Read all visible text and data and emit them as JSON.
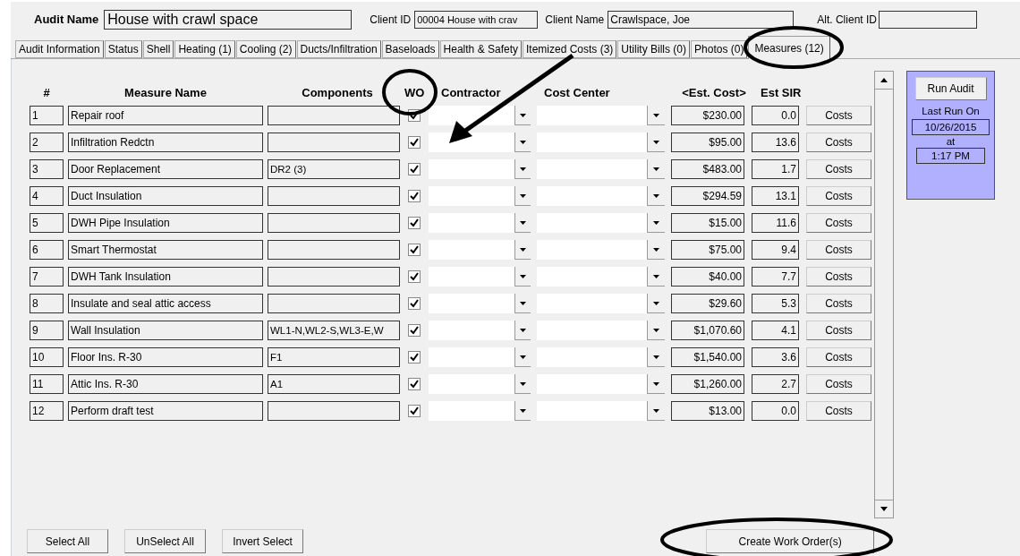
{
  "header": {
    "audit_name_label": "Audit Name",
    "audit_name": "House with crawl space",
    "client_id_label": "Client ID",
    "client_id": "00004 House with crav",
    "client_name_label": "Client Name",
    "client_name": "Crawlspace, Joe",
    "alt_client_id_label": "Alt. Client ID"
  },
  "tabs": [
    {
      "label": "Audit Information",
      "selected": false
    },
    {
      "label": "Status",
      "selected": false
    },
    {
      "label": "Shell",
      "selected": false
    },
    {
      "label": "Heating (1)",
      "selected": false
    },
    {
      "label": "Cooling (2)",
      "selected": false
    },
    {
      "label": "Ducts/Infiltration",
      "selected": false
    },
    {
      "label": "Baseloads",
      "selected": false
    },
    {
      "label": "Health & Safety",
      "selected": false
    },
    {
      "label": "Itemized Costs (3)",
      "selected": false
    },
    {
      "label": "Utility Bills (0)",
      "selected": false
    },
    {
      "label": "Photos (0)",
      "selected": false
    },
    {
      "label": "Measures (12)",
      "selected": true
    }
  ],
  "columns": [
    "#",
    "Measure Name",
    "Components",
    "WO",
    "Contractor",
    "Cost Center",
    "<Est. Cost>",
    "Est SIR"
  ],
  "rows": [
    {
      "number": "1",
      "name": "Repair roof",
      "components": "",
      "wo": true,
      "est_cost": "$230.00",
      "est_sir": "0.0",
      "button": "Costs"
    },
    {
      "number": "2",
      "name": "Infiltration Redctn",
      "components": "",
      "wo": true,
      "est_cost": "$95.00",
      "est_sir": "13.6",
      "button": "Costs"
    },
    {
      "number": "3",
      "name": "Door Replacement",
      "components": "DR2 (3)",
      "wo": true,
      "est_cost": "$483.00",
      "est_sir": "1.7",
      "button": "Costs"
    },
    {
      "number": "4",
      "name": "Duct Insulation",
      "components": "",
      "wo": true,
      "est_cost": "$294.59",
      "est_sir": "13.1",
      "button": "Costs"
    },
    {
      "number": "5",
      "name": "DWH Pipe Insulation",
      "components": "",
      "wo": true,
      "est_cost": "$15.00",
      "est_sir": "11.6",
      "button": "Costs"
    },
    {
      "number": "6",
      "name": "Smart Thermostat",
      "components": "",
      "wo": true,
      "est_cost": "$75.00",
      "est_sir": "9.4",
      "button": "Costs"
    },
    {
      "number": "7",
      "name": "DWH Tank Insulation",
      "components": "",
      "wo": true,
      "est_cost": "$40.00",
      "est_sir": "7.7",
      "button": "Costs"
    },
    {
      "number": "8",
      "name": "Insulate and seal attic access",
      "components": "",
      "wo": true,
      "est_cost": "$29.60",
      "est_sir": "5.3",
      "button": "Costs"
    },
    {
      "number": "9",
      "name": "Wall Insulation",
      "components": "WL1-N,WL2-S,WL3-E,W",
      "wo": true,
      "est_cost": "$1,070.60",
      "est_sir": "4.1",
      "button": "Costs"
    },
    {
      "number": "10",
      "name": "Floor Ins. R-30",
      "components": "F1",
      "wo": true,
      "est_cost": "$1,540.00",
      "est_sir": "3.6",
      "button": "Costs"
    },
    {
      "number": "11",
      "name": "Attic Ins. R-30",
      "components": "A1",
      "wo": true,
      "est_cost": "$1,260.00",
      "est_sir": "2.7",
      "button": "Costs"
    },
    {
      "number": "12",
      "name": "Perform draft test",
      "components": "",
      "wo": true,
      "est_cost": "$13.00",
      "est_sir": "0.0",
      "button": "Costs"
    }
  ],
  "side_panel": {
    "button": "Run Audit",
    "last_run_label": "Last Run On",
    "date": "10/26/2015",
    "at_label": "at",
    "time": "1:17 PM"
  },
  "bottom_buttons": [
    "Select All",
    "UnSelect All",
    "Invert Select"
  ],
  "create_button": "Create Work Order(s)"
}
